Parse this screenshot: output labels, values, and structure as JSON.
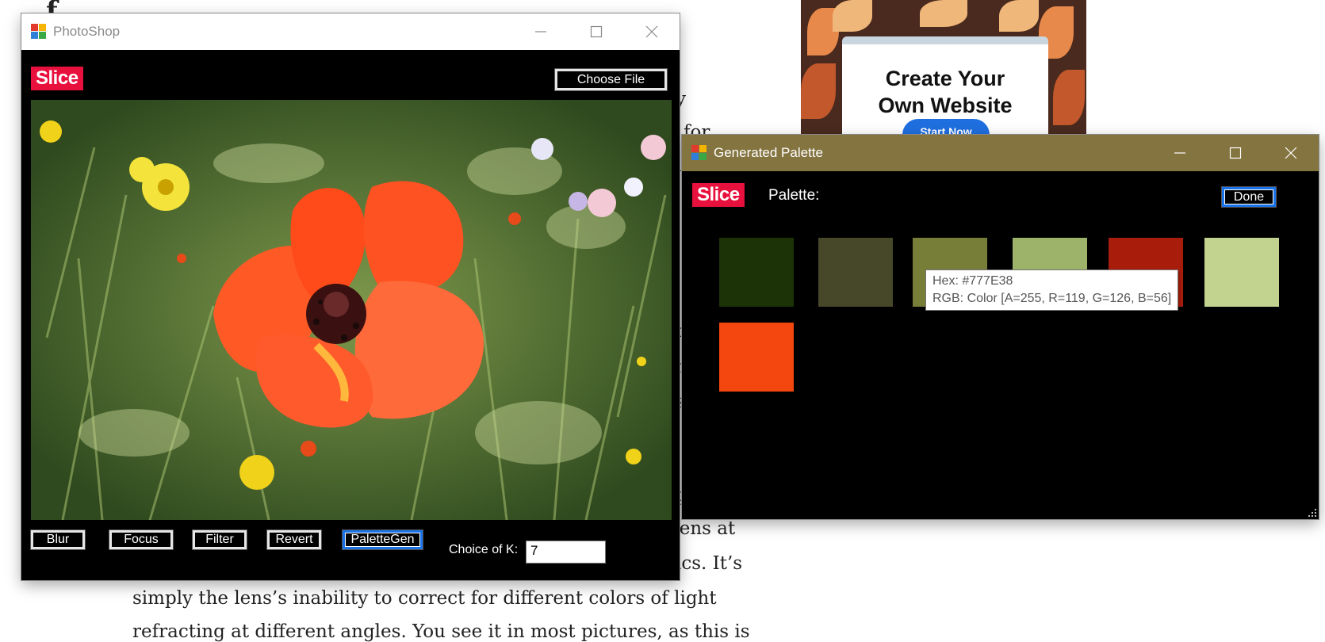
{
  "article": {
    "lines": [
      "f",
      "y",
      "g for",
      "i",
      "r",
      "n",
      "s",
      "p",
      "pens at",
      "ics. It’s",
      "simply the lens’s inability to correct for different colors of light",
      "refracting at different angles. You see it in most pictures, as this is"
    ]
  },
  "ad": {
    "headline": "Create Your\nOwn Website",
    "cta": "Start Now"
  },
  "photoshop_window": {
    "title": "PhotoShop",
    "logo": "Slice",
    "choose_file_label": "Choose File",
    "buttons": {
      "blur": "Blur",
      "focus": "Focus",
      "filter": "Filter",
      "revert": "Revert",
      "palettegen": "PaletteGen"
    },
    "k_label": "Choice of K:",
    "k_value": "7"
  },
  "palette_window": {
    "title": "Generated Palette",
    "logo": "Slice",
    "palette_label": "Palette:",
    "done_label": "Done",
    "swatches": [
      "#1b3307",
      "#47472a",
      "#777e38",
      "#9db36a",
      "#a81c0c",
      "#c2d38f",
      "#f4460f"
    ],
    "tooltip": {
      "hex_line": "Hex: #777E38",
      "rgb_line": "RGB: Color [A=255, R=119, G=126, B=56]"
    }
  },
  "colors": {
    "palette_titlebar": "#847440",
    "slice_logo_bg": "#e8103c",
    "focus_blue": "#1a73e8"
  }
}
